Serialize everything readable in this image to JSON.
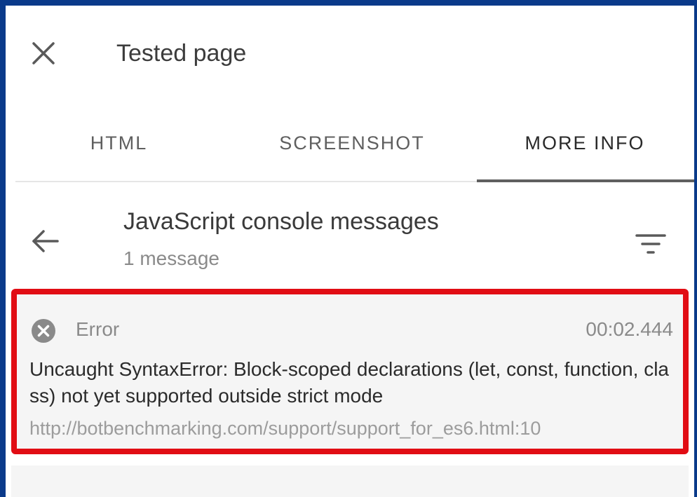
{
  "header": {
    "title": "Tested page",
    "close_icon": "close-icon"
  },
  "tabs": [
    {
      "label": "HTML",
      "active": false
    },
    {
      "label": "SCREENSHOT",
      "active": false
    },
    {
      "label": "MORE INFO",
      "active": true
    }
  ],
  "section": {
    "title": "JavaScript console messages",
    "subtitle": "1 message",
    "back_icon": "arrow-back-icon",
    "filter_icon": "filter-icon"
  },
  "message": {
    "level": "Error",
    "timestamp": "00:02.444",
    "text": "Uncaught SyntaxError: Block-scoped declarations (let, const, function, class) not yet supported outside strict mode",
    "url": "http://botbenchmarking.com/support/support_for_es6.html:10",
    "icon": "error-circle-icon"
  },
  "colors": {
    "frame": "#0a3a8a",
    "highlight_border": "#e10d14",
    "message_bg": "#f5f5f5",
    "active_indicator": "#5f5f5f"
  }
}
